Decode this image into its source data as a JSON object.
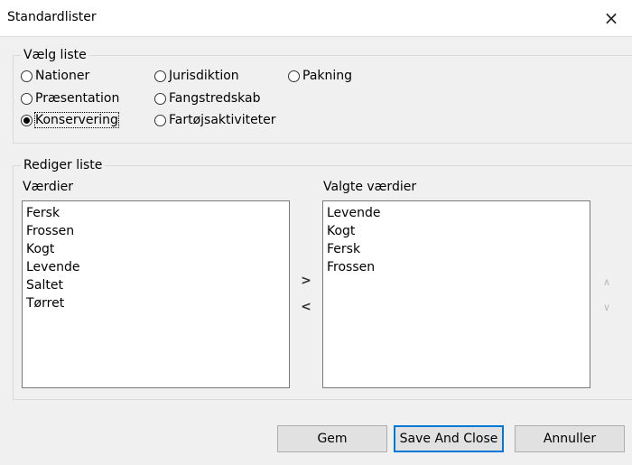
{
  "window": {
    "title": "Standardlister",
    "close_icon": "×"
  },
  "choose_list": {
    "label": "Vælg liste",
    "options": [
      {
        "label": "Nationer",
        "checked": false
      },
      {
        "label": "Præsentation",
        "checked": false
      },
      {
        "label": "Konservering",
        "checked": true
      },
      {
        "label": "Jurisdiktion",
        "checked": false
      },
      {
        "label": "Fangstredskab",
        "checked": false
      },
      {
        "label": "Fartøjsaktiviteter",
        "checked": false
      },
      {
        "label": "Pakning",
        "checked": false
      }
    ]
  },
  "edit_list": {
    "label": "Rediger liste",
    "values_label": "Værdier",
    "selected_label": "Valgte værdier",
    "values": [
      "Fersk",
      "Frossen",
      "Kogt",
      "Levende",
      "Saltet",
      "Tørret"
    ],
    "selected": [
      "Levende",
      "Kogt",
      "Fersk",
      "Frossen"
    ],
    "move_right": ">",
    "move_left": "<",
    "move_up": "∧",
    "move_down": "∨"
  },
  "buttons": {
    "save": "Gem",
    "save_close": "Save And Close",
    "cancel": "Annuller"
  },
  "colors": {
    "accent": "#0078d7",
    "background": "#f0f0f0"
  }
}
